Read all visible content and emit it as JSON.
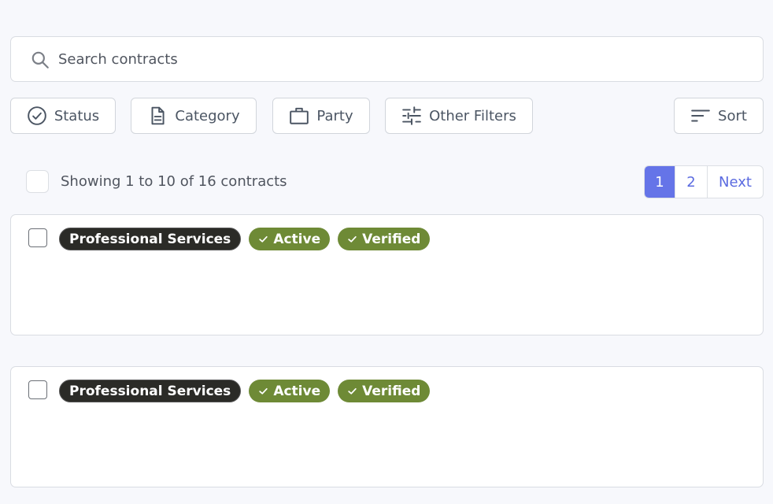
{
  "search": {
    "placeholder": "Search contracts",
    "value": "",
    "icon": "search-icon"
  },
  "filters": {
    "status": {
      "label": "Status",
      "icon": "check-circle-icon"
    },
    "category": {
      "label": "Category",
      "icon": "document-icon"
    },
    "party": {
      "label": "Party",
      "icon": "briefcase-icon"
    },
    "other": {
      "label": "Other Filters",
      "icon": "sliders-icon"
    },
    "sort": {
      "label": "Sort",
      "icon": "sort-lines-icon"
    }
  },
  "list_header": {
    "showing_text": "Showing 1 to 10 of 16 contracts",
    "select_all_checked": false
  },
  "pagination": {
    "pages": [
      "1",
      "2"
    ],
    "current_page": "1",
    "next_label": "Next"
  },
  "colors": {
    "accent": "#6574e8",
    "badge_category_bg": "#2b2b27",
    "badge_status_bg": "#6e8a36",
    "page_bg": "#f7f8fc"
  },
  "contracts": [
    {
      "checked": false,
      "category": "Professional Services",
      "status": "Active",
      "verification": "Verified"
    },
    {
      "checked": false,
      "category": "Professional Services",
      "status": "Active",
      "verification": "Verified"
    }
  ]
}
